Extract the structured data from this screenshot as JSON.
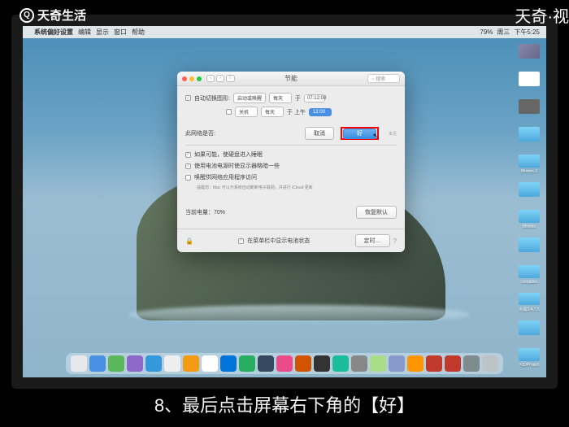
{
  "watermark": {
    "left": "天奇生活",
    "right": "天奇·视"
  },
  "menubar": {
    "apple": "",
    "app": "系统偏好设置",
    "items": [
      "编辑",
      "显示",
      "窗口",
      "帮助"
    ],
    "right": {
      "battery": "79%",
      "day": "周三",
      "time": "下午5:25"
    }
  },
  "window": {
    "title": "节能",
    "search_placeholder": "搜索",
    "schedule": {
      "label": "自动切换图形:",
      "row1": {
        "opt": "启动或唤醒",
        "every": "每天",
        "time_hint": "于",
        "time": "07:12:00"
      },
      "row2": {
        "opt": "关机",
        "every": "每天",
        "time_hint": "于 上午",
        "time": "12:00"
      }
    },
    "confirm": {
      "prompt": "此网络是否:",
      "cancel": "取消",
      "ok": "好"
    },
    "checks": [
      {
        "on": true,
        "text": "如果可能，使硬盘进入睡眠"
      },
      {
        "on": true,
        "text": "使用电池电源时使显示器略暗一些"
      },
      {
        "on": false,
        "text": "唤醒供网络应用程序访问"
      }
    ],
    "note": "提醒您：Mac 可以与系统自动断断电子联网，并进行 iCloud 更新",
    "battery_level": "当前电量：70%",
    "restore": "恢复默认",
    "show_battery": "在菜单栏中显示电池状态",
    "schedule_btn": "定时…"
  },
  "desktop_icons": [
    "",
    "",
    "",
    "",
    "Movies 3",
    "",
    "Movies",
    "",
    "compiles",
    "水晶3.4.7.5",
    "",
    ">2DProject"
  ],
  "dock_colors": [
    "#e8e8ec",
    "#4a90e2",
    "#5bb75b",
    "#8d68c9",
    "#3498db",
    "#eee",
    "#f39c12",
    "#fff",
    "#0074d9",
    "#27ae60",
    "#34495e",
    "#ea4c89",
    "#d35400",
    "#333",
    "#1abc9c",
    "#888",
    "#ad8",
    "#89c",
    "#ff9500",
    "#c0392b",
    "#c0392b",
    "#7f8c8d",
    "#bdc3c7"
  ],
  "caption": "8、最后点击屏幕右下角的【好】"
}
